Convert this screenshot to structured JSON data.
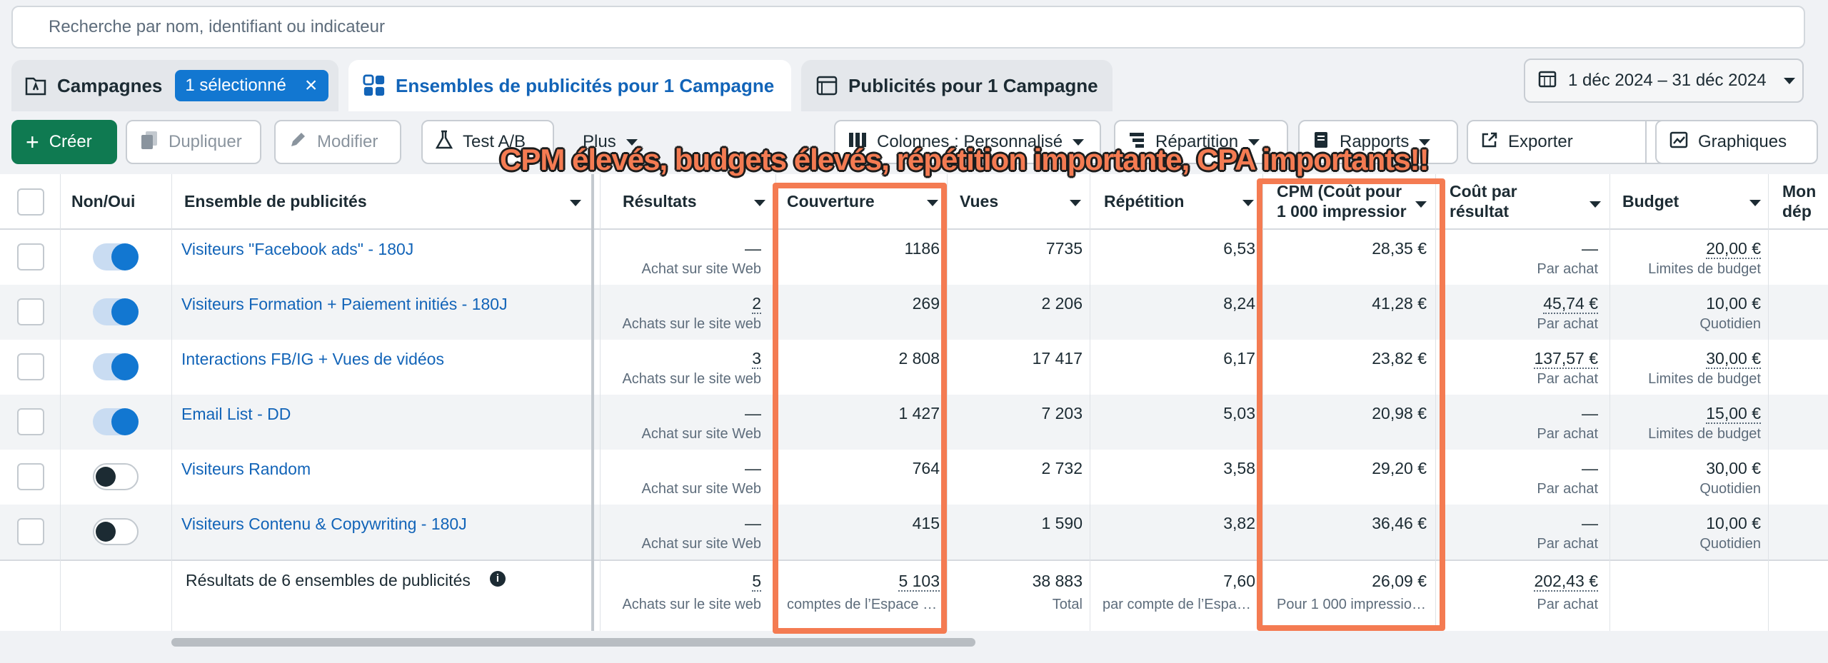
{
  "search": {
    "placeholder": "Recherche par nom, identifiant ou indicateur"
  },
  "tabs": {
    "campaigns": {
      "label": "Campagnes",
      "badge": "1 sélectionné",
      "close": "×"
    },
    "adsets": {
      "label": "Ensembles de publicités pour 1 Campagne"
    },
    "ads": {
      "label": "Publicités pour 1 Campagne"
    }
  },
  "date_range": "1 déc 2024 – 31 déc 2024",
  "toolbar": {
    "create": "Créer",
    "duplicate": "Dupliquer",
    "edit": "Modifier",
    "abtest": "Test A/B",
    "more": "Plus",
    "columns": "Colonnes : Personnalisé",
    "breakdown": "Répartition",
    "reports": "Rapports",
    "export": "Exporter",
    "charts": "Graphiques"
  },
  "columns": {
    "toggle": "Non/Oui",
    "name": "Ensemble de publicités",
    "results": "Résultats",
    "reach": "Couverture",
    "views": "Vues",
    "frequency": "Répétition",
    "cpm_line1": "CPM (Coût pour",
    "cpm_line2": "1 000 impressior",
    "cpr_line1": "Coût par",
    "cpr_line2": "résultat",
    "budget": "Budget",
    "spent_line1": "Mon",
    "spent_line2": "dép"
  },
  "rows": [
    {
      "name": "Visiteurs \"Facebook ads\" - 180J",
      "on": true,
      "results": "—",
      "results_sub": "Achat sur site Web",
      "reach": "1186",
      "views": "7735",
      "frequency": "6,53",
      "cpm": "28,35 €",
      "cpr": "—",
      "cpr_sub": "Par achat",
      "budget": "20,00 €",
      "budget_sub": "Limites de budget"
    },
    {
      "name": "Visiteurs Formation + Paiement initiés - 180J",
      "on": true,
      "results": "2",
      "results_sub": "Achats sur le site web",
      "reach": "269",
      "views": "2 206",
      "frequency": "8,24",
      "cpm": "41,28 €",
      "cpr": "45,74 €",
      "cpr_sub": "Par achat",
      "budget": "10,00 €",
      "budget_sub": "Quotidien"
    },
    {
      "name": "Interactions FB/IG + Vues de vidéos",
      "on": true,
      "results": "3",
      "results_sub": "Achats sur le site web",
      "reach": "2 808",
      "views": "17 417",
      "frequency": "6,17",
      "cpm": "23,82 €",
      "cpr": "137,57 €",
      "cpr_sub": "Par achat",
      "budget": "30,00 €",
      "budget_sub": "Limites de budget"
    },
    {
      "name": "Email List - DD",
      "on": true,
      "results": "—",
      "results_sub": "Achat sur site Web",
      "reach": "1 427",
      "views": "7 203",
      "frequency": "5,03",
      "cpm": "20,98 €",
      "cpr": "—",
      "cpr_sub": "Par achat",
      "budget": "15,00 €",
      "budget_sub": "Limites de budget"
    },
    {
      "name": "Visiteurs Random",
      "on": false,
      "results": "—",
      "results_sub": "Achat sur site Web",
      "reach": "764",
      "views": "2 732",
      "frequency": "3,58",
      "cpm": "29,20 €",
      "cpr": "—",
      "cpr_sub": "Par achat",
      "budget": "30,00 €",
      "budget_sub": "Quotidien"
    },
    {
      "name": "Visiteurs Contenu & Copywriting - 180J",
      "on": false,
      "results": "—",
      "results_sub": "Achat sur site Web",
      "reach": "415",
      "views": "1 590",
      "frequency": "3,82",
      "cpm": "36,46 €",
      "cpr": "—",
      "cpr_sub": "Par achat",
      "budget": "10,00 €",
      "budget_sub": "Quotidien"
    }
  ],
  "summary": {
    "label": "Résultats de 6 ensembles de publicités",
    "results": "5",
    "results_sub": "Achats sur le site web",
    "reach": "5 103",
    "reach_sub": "comptes de l’Espace …",
    "views": "38 883",
    "views_sub": "Total",
    "frequency": "7,60",
    "frequency_sub": "par compte de l’Espa…",
    "cpm": "26,09 €",
    "cpm_sub": "Pour 1 000 impressio…",
    "cpr": "202,43 €",
    "cpr_sub": "Par achat"
  },
  "annotation": "CPM élevés, budgets élevés, répétition importante, CPA importants!!",
  "colors": {
    "accent": "#1277d1",
    "create": "#0f7a51",
    "highlight": "#f47b52"
  }
}
